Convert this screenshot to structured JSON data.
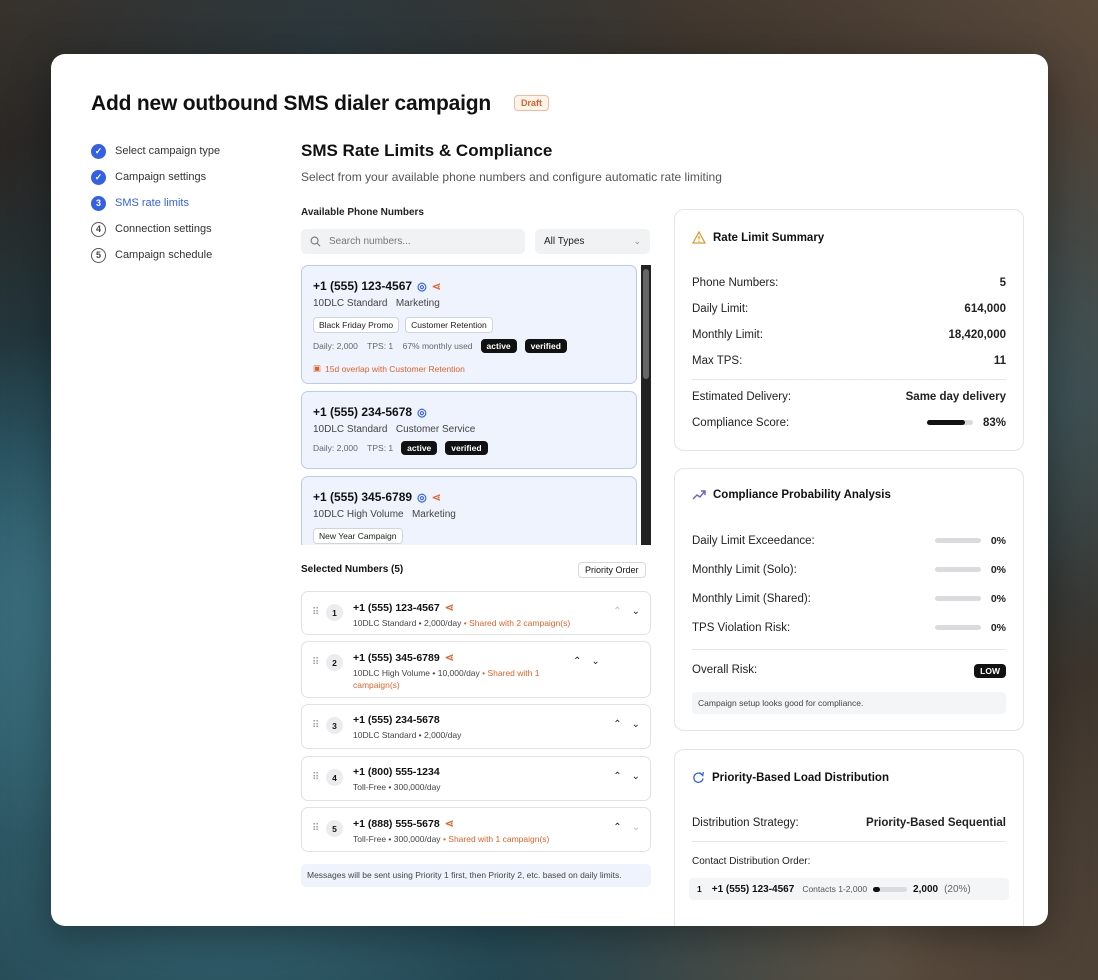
{
  "page": {
    "title": "Add new outbound SMS dialer campaign",
    "badge": "Draft"
  },
  "steps": [
    {
      "label": "Select campaign type",
      "state": "done",
      "marker": "✓"
    },
    {
      "label": "Campaign settings",
      "state": "done",
      "marker": "✓"
    },
    {
      "label": "SMS rate limits",
      "state": "current",
      "marker": "3"
    },
    {
      "label": "Connection settings",
      "state": "todo",
      "marker": "4"
    },
    {
      "label": "Campaign schedule",
      "state": "todo",
      "marker": "5"
    }
  ],
  "section": {
    "title": "SMS Rate Limits & Compliance",
    "subtitle": "Select from your available phone numbers and configure automatic rate limiting",
    "available_label": "Available Phone Numbers",
    "search_placeholder": "Search numbers...",
    "type_filter": "All Types"
  },
  "available_numbers": [
    {
      "phone": "+1 (555) 123-4567",
      "type": "10DLC Standard",
      "use": "Marketing",
      "tags": [
        "Black Friday Promo",
        "Customer Retention"
      ],
      "stats": "Daily: 2,000    TPS: 1    67% monthly used",
      "pills": [
        "active",
        "verified"
      ],
      "overlap": "15d overlap with Customer Retention"
    },
    {
      "phone": "+1 (555) 234-5678",
      "type": "10DLC Standard",
      "use": "Customer Service",
      "stats": "Daily: 2,000    TPS: 1",
      "pills": [
        "active",
        "verified"
      ]
    },
    {
      "phone": "+1 (555) 345-6789",
      "type": "10DLC High Volume",
      "use": "Marketing",
      "tags": [
        "New Year Campaign"
      ]
    }
  ],
  "selected": {
    "label": "Selected Numbers (5)",
    "priority_button": "Priority Order",
    "rows": [
      {
        "index": "1",
        "phone": "+1 (555) 123-4567",
        "desc": "10DLC Standard • 2,000/day",
        "shared": "• Shared with 2 campaign(s)"
      },
      {
        "index": "2",
        "phone": "+1 (555) 345-6789",
        "desc": "10DLC High Volume • 10,000/day",
        "shared": "• Shared with 1 campaign(s)"
      },
      {
        "index": "3",
        "phone": "+1 (555) 234-5678",
        "desc": "10DLC Standard • 2,000/day",
        "shared": ""
      },
      {
        "index": "4",
        "phone": "+1 (800) 555-1234",
        "desc": "Toll-Free • 300,000/day",
        "shared": ""
      },
      {
        "index": "5",
        "phone": "+1 (888) 555-5678",
        "desc": "Toll-Free • 300,000/day",
        "shared": "• Shared with 1 campaign(s)"
      }
    ],
    "note": "Messages will be sent using Priority 1 first, then Priority 2, etc. based on daily limits."
  },
  "summary": {
    "title": "Rate Limit Summary",
    "rows": [
      {
        "label": "Phone Numbers:",
        "value": "5"
      },
      {
        "label": "Daily Limit:",
        "value": "614,000"
      },
      {
        "label": "Monthly Limit:",
        "value": "18,420,000"
      },
      {
        "label": "Max TPS:",
        "value": "11"
      }
    ],
    "delivery_label": "Estimated Delivery:",
    "delivery_value": "Same day delivery",
    "compliance_label": "Compliance Score:",
    "compliance_value": "83%",
    "compliance_fraction": 0.83
  },
  "probability": {
    "title": "Compliance Probability Analysis",
    "rows": [
      {
        "label": "Daily Limit Exceedance:",
        "value": "0%"
      },
      {
        "label": "Monthly Limit (Solo):",
        "value": "0%"
      },
      {
        "label": "Monthly Limit (Shared):",
        "value": "0%"
      },
      {
        "label": "TPS Violation Risk:",
        "value": "0%"
      }
    ],
    "overall_label": "Overall Risk:",
    "overall_value": "LOW",
    "note": "Campaign setup looks good for compliance."
  },
  "distribution": {
    "title": "Priority-Based Load Distribution",
    "strategy_label": "Distribution Strategy:",
    "strategy_value": "Priority-Based Sequential",
    "order_label": "Contact Distribution Order:",
    "first": {
      "index": "1",
      "phone": "+1 (555) 123-4567",
      "contacts": "Contacts 1-2,000",
      "count": "2,000",
      "pct": "(20%)",
      "fraction": 0.2
    }
  },
  "colors": {
    "accent": "#3360e6",
    "warning": "#e0632c"
  }
}
